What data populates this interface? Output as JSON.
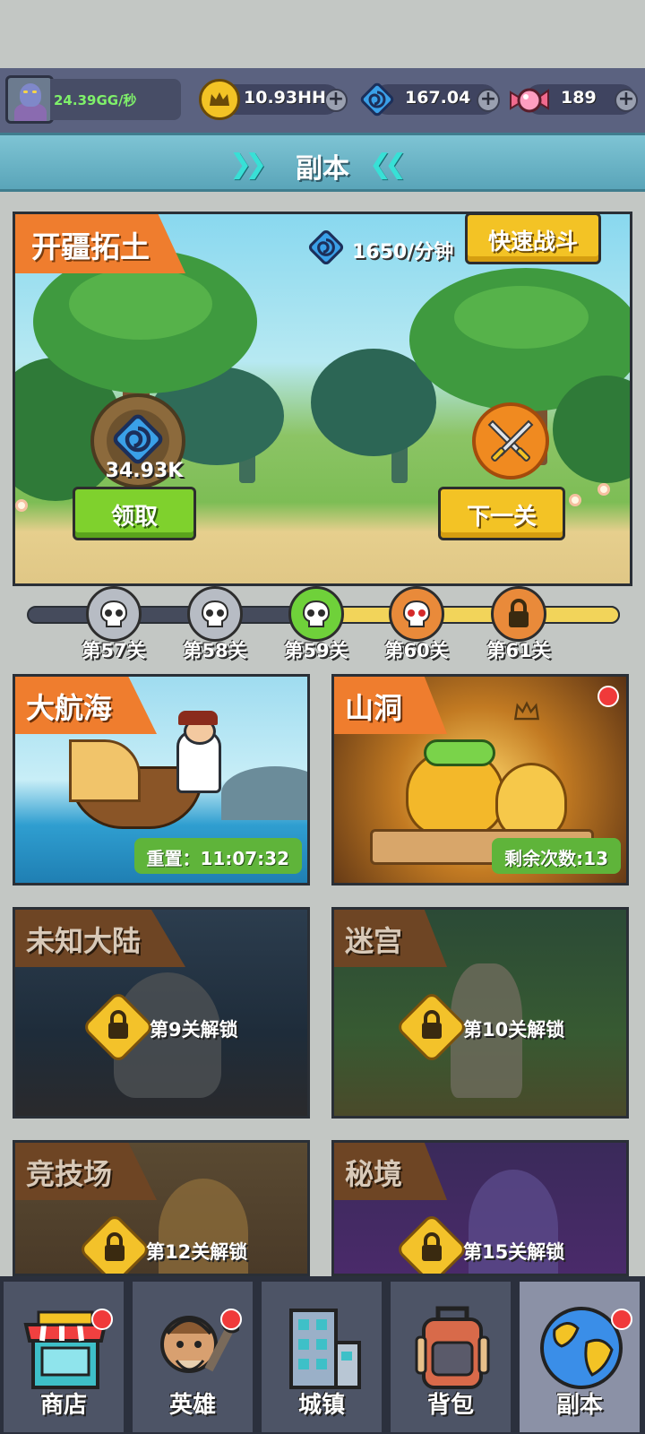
{
  "header": {
    "rate": "24.39GG/秒",
    "crown_value": "10.93HH",
    "gem_value": "167.04",
    "candy_value": "189",
    "title": "副本"
  },
  "main_dungeon": {
    "name": "开疆拓土",
    "rate": "1650/分钟",
    "quick_battle_label": "快速战斗",
    "collect_amount": "34.93K",
    "collect_label": "领取",
    "next_label": "下一关"
  },
  "stages": [
    {
      "label": "第57关",
      "state": "cleared"
    },
    {
      "label": "第58关",
      "state": "cleared"
    },
    {
      "label": "第59关",
      "state": "current"
    },
    {
      "label": "第60关",
      "state": "boss"
    },
    {
      "label": "第61关",
      "state": "locked"
    }
  ],
  "cards": {
    "voyage": {
      "name": "大航海",
      "status": "重置：11:07:32"
    },
    "cave": {
      "name": "山洞",
      "status": "剩余次数:13"
    },
    "unknown_land": {
      "name": "未知大陆",
      "lock_text": "第9关解锁"
    },
    "maze": {
      "name": "迷宫",
      "lock_text": "第10关解锁"
    },
    "arena": {
      "name": "竞技场",
      "lock_text": "第12关解锁"
    },
    "secret": {
      "name": "秘境",
      "lock_text": "第15关解锁"
    }
  },
  "nav": [
    {
      "label": "商店",
      "icon": "shop-icon",
      "badge": true
    },
    {
      "label": "英雄",
      "icon": "hero-icon",
      "badge": true
    },
    {
      "label": "城镇",
      "icon": "town-icon",
      "badge": false
    },
    {
      "label": "背包",
      "icon": "backpack-icon",
      "badge": false
    },
    {
      "label": "副本",
      "icon": "globe-icon",
      "badge": true,
      "active": true
    }
  ],
  "colors": {
    "accent_orange": "#ef7d2e",
    "button_yellow": "#f3c325",
    "button_green": "#7fd12d",
    "rate_green": "#7ff06a"
  }
}
